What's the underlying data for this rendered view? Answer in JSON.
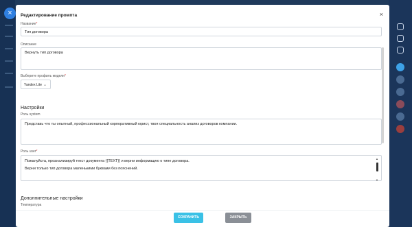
{
  "modal": {
    "title": "Редактирование промпта",
    "close_glyph": "×"
  },
  "fields": {
    "name": {
      "label": "Название",
      "required_mark": "*",
      "value": "Тип договора"
    },
    "description": {
      "label": "Описание",
      "value": "Вернуть тип договора"
    },
    "model_profile": {
      "label": "Выберите профиль модели",
      "required_mark": "*",
      "value": "Yandex Lite",
      "chevron": "⌄"
    }
  },
  "settings": {
    "title": "Настройки",
    "system_role": {
      "label": "Роль system",
      "value": "Представь что ты опытный, профессиональный корпоративный юрист, твоя специальность анализ договоров компании."
    },
    "user_role": {
      "label": "Роль user",
      "required_mark": "*",
      "line1": "Пожалуйста, проанализируй текст документа {{TEXT}} и верни информацию о типе договора.",
      "line2": "Верни только тип договора маленькими буквами без пояснений."
    }
  },
  "advanced": {
    "title": "Дополнительные настройки",
    "temperature_label": "Температура"
  },
  "footer": {
    "save_label": "СОХРАНИТЬ",
    "close_label": "ЗАКРЫТЬ"
  },
  "colors": {
    "accent": "#3ac1e6",
    "secondary_button": "#8a8f96",
    "backdrop": "#1f3a5b"
  },
  "icons": {
    "rail_close": "close-icon",
    "modal_close": "close-icon",
    "select_chevron": "chevron-down-icon"
  }
}
